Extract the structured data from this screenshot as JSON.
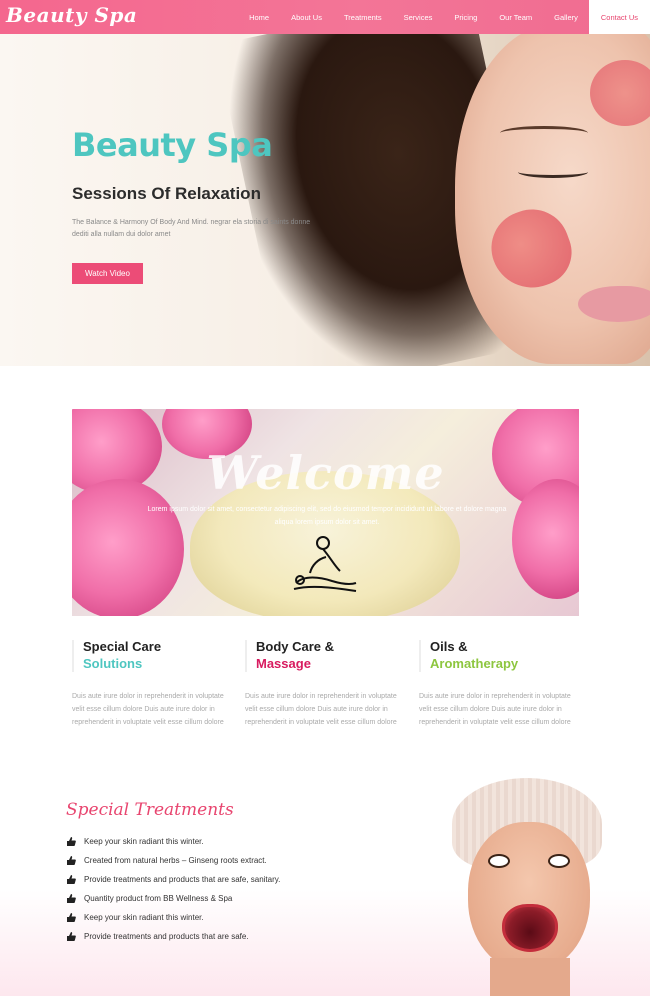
{
  "brand": {
    "logo_text": "Beauty Spa",
    "accent": "#f06b90",
    "teal": "#4ec6c0",
    "green": "#8dc63f",
    "dark_pink": "#c2185b"
  },
  "nav": {
    "items": [
      "Home",
      "About Us",
      "Treatments",
      "Services",
      "Pricing",
      "Our Team",
      "Gallery",
      "Contact Us"
    ]
  },
  "hero": {
    "title": "Beauty Spa",
    "subtitle": "Sessions Of Relaxation",
    "text": "The Balance & Harmony Of Body And Mind. negrar ela storia di saints donne dediti alla nullam dui dolor amet",
    "button": "Watch Video"
  },
  "welcome": {
    "title": "Welcome",
    "text": "Lorem ipsum dolor sit amet, consectetur adipiscing elit, sed do eiusmod tempor incididunt ut labore et dolore magna aliqua lorem ipsum dolor sit amet."
  },
  "features": [
    {
      "line1": "Special Care",
      "line2": "Solutions",
      "color": "#4ec6c0",
      "text": "Duis aute irure dolor in reprehenderit in voluptate velit esse cillum dolore Duis aute irure dolor in reprehenderit in voluptate velit esse cillum dolore"
    },
    {
      "line1": "Body Care &",
      "line2": "Massage",
      "color": "#d81b60",
      "text": "Duis aute irure dolor in reprehenderit in voluptate velit esse cillum dolore Duis aute irure dolor in reprehenderit in voluptate velit esse cillum dolore"
    },
    {
      "line1": "Oils &",
      "line2": "Aromatherapy",
      "color": "#8dc63f",
      "text": "Duis aute irure dolor in reprehenderit in voluptate velit esse cillum dolore Duis aute irure dolor in reprehenderit in voluptate velit esse cillum dolore"
    }
  ],
  "special": {
    "title": "Special Treatments",
    "items": [
      "Keep your skin radiant this winter.",
      "Created from natural herbs – Ginseng roots extract.",
      "Provide treatments and products that are safe, sanitary.",
      "Quantity product from BB Wellness & Spa",
      "Keep your skin radiant this winter.",
      "Provide treatments and products that are safe."
    ],
    "item_icon": "thumbs-up-icon"
  }
}
